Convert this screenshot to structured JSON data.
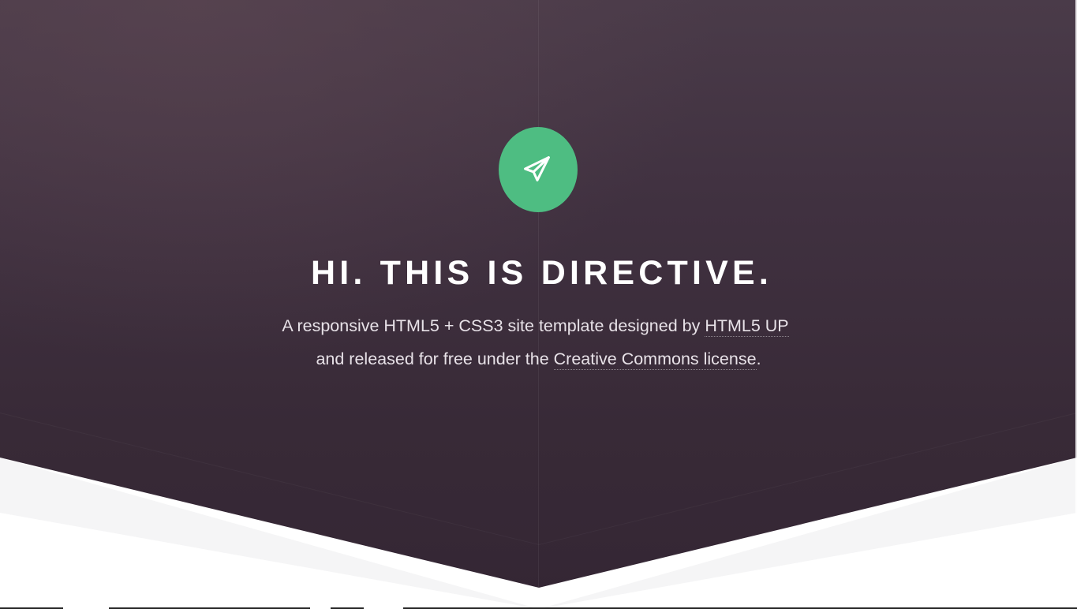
{
  "header": {
    "icon": "paper-plane-icon",
    "title": "HI. THIS IS DIRECTIVE.",
    "subtitle": {
      "line1_prefix": "A responsive HTML5 + CSS3 site template designed by ",
      "link_author": "HTML5 UP",
      "line2_prefix": "and released for free under the ",
      "link_license": "Creative Commons license",
      "line2_suffix": "."
    },
    "colors": {
      "accent": "#4ebd82",
      "background": "#3d2e3d",
      "text": "#ffffff"
    }
  }
}
